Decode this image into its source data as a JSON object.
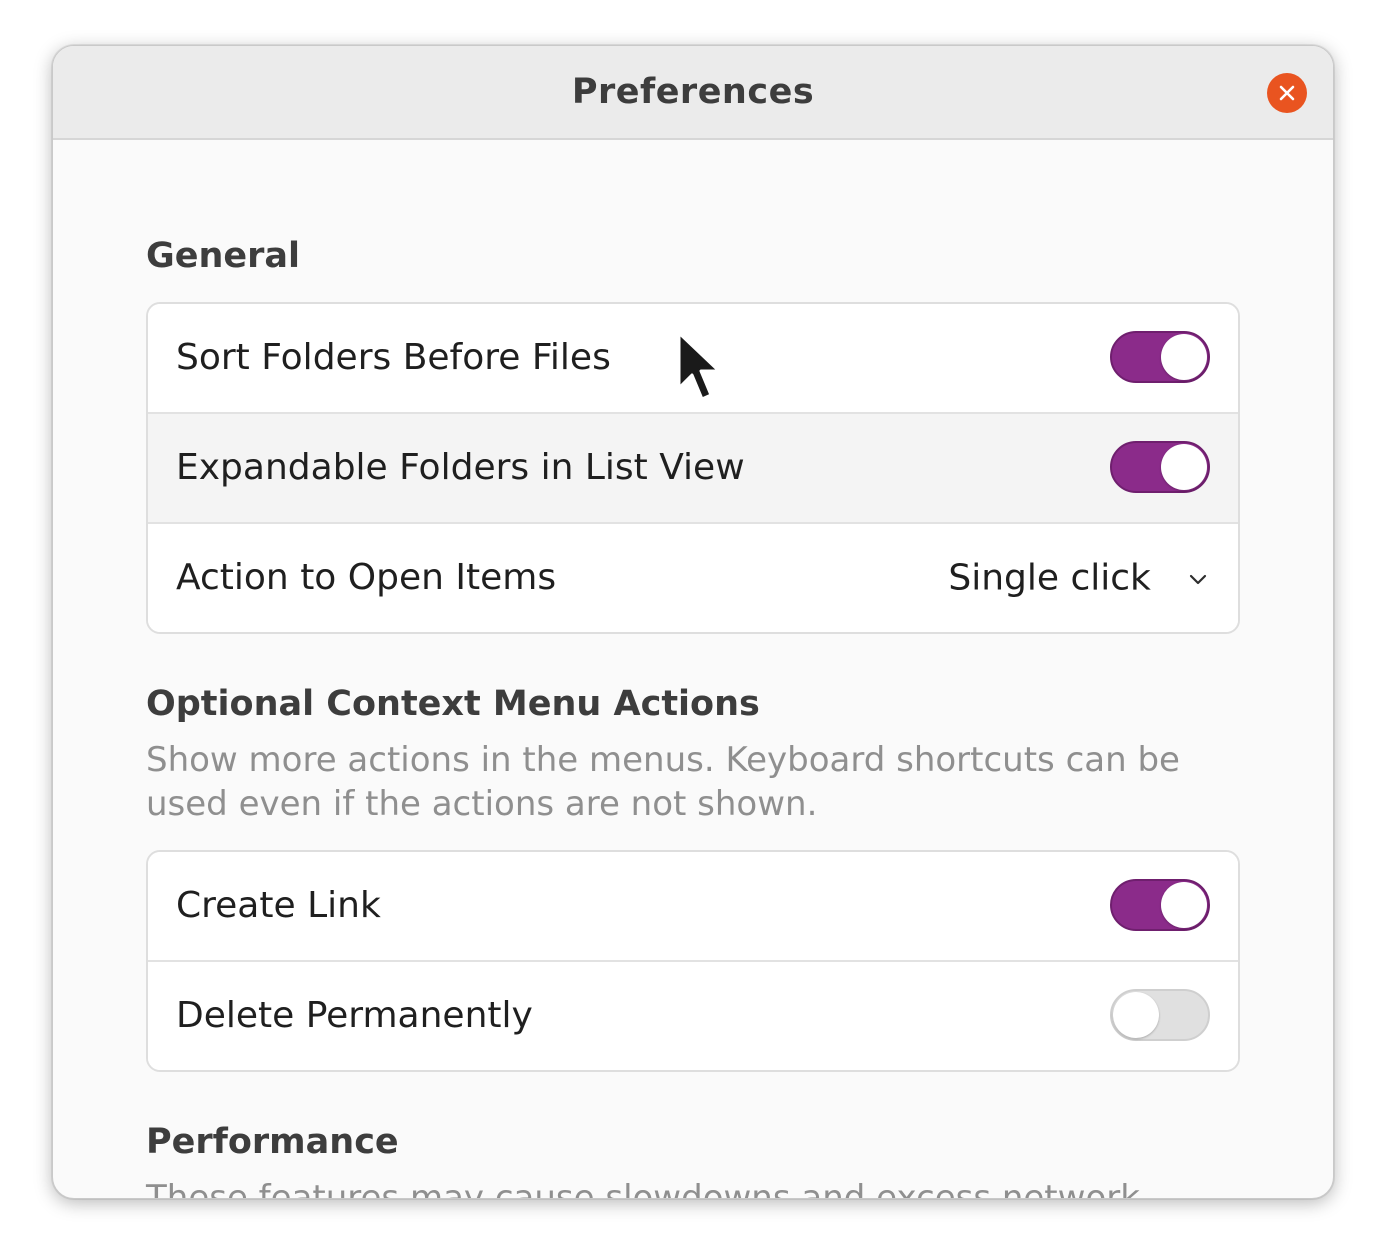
{
  "window": {
    "title": "Preferences",
    "close_icon": "close-icon",
    "accent_color": "#e95420"
  },
  "general": {
    "heading": "General",
    "rows": [
      {
        "label": "Sort Folders Before Files",
        "type": "switch",
        "state": "on"
      },
      {
        "label": "Expandable Folders in List View",
        "type": "switch",
        "state": "on"
      },
      {
        "label": "Action to Open Items",
        "type": "dropdown",
        "value": "Single click"
      }
    ]
  },
  "context_menu": {
    "heading": "Optional Context Menu Actions",
    "description": "Show more actions in the menus. Keyboard shortcuts can be used even if the actions are not shown.",
    "rows": [
      {
        "label": "Create Link",
        "type": "switch",
        "state": "on"
      },
      {
        "label": "Delete Permanently",
        "type": "switch",
        "state": "off"
      }
    ]
  },
  "performance": {
    "heading": "Performance",
    "description": "These features may cause slowdowns and excess network usage, especially when browsing files outside this computer, such as on"
  },
  "colors": {
    "switch_on": "#8b2b8a",
    "switch_off": "#e0e0e0"
  }
}
